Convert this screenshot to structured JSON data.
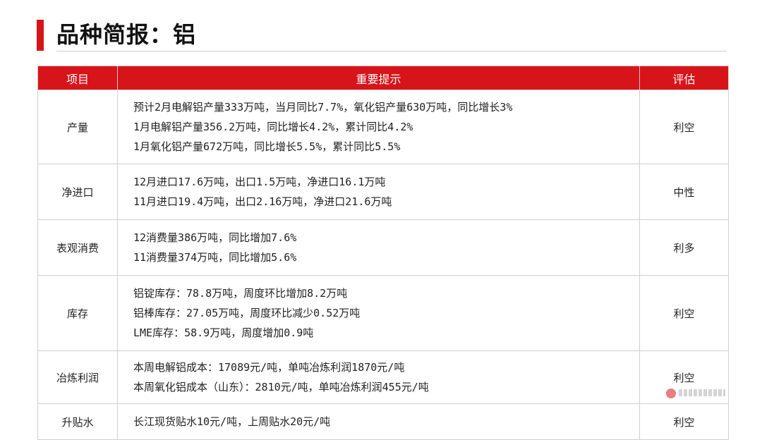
{
  "page": {
    "title": "品种简报：铝"
  },
  "table": {
    "headers": [
      "项目",
      "重要提示",
      "评估"
    ],
    "rows": [
      {
        "item": "产量",
        "hints": [
          "预计2月电解铝产量333万吨，当月同比7.7%，氧化铝产量630万吨，同比增长3%",
          "1月电解铝产量356.2万吨，同比增长4.2%，累计同比4.2%",
          "1月氧化铝产量672万吨，同比增长5.5%，累计同比5.5%"
        ],
        "assessment": "利空"
      },
      {
        "item": "净进口",
        "hints": [
          "12月进口17.6万吨，出口1.5万吨，净进口16.1万吨",
          "11月进口19.4万吨，出口2.16万吨，净进口21.6万吨"
        ],
        "assessment": "中性"
      },
      {
        "item": "表观消费",
        "hints": [
          "12消费量386万吨，同比增加7.6%",
          "11消费量374万吨，同比增加5.6%"
        ],
        "assessment": "利多"
      },
      {
        "item": "库存",
        "hints": [
          "铝锭库存：78.8万吨，周度环比增加8.2万吨",
          "铝棒库存：27.05万吨，周度环比减少0.52万吨",
          "LME库存：58.9万吨，周度增加0.9吨"
        ],
        "assessment": "利空"
      },
      {
        "item": "冶炼利润",
        "hints": [
          "本周电解铝成本：17089元/吨，单吨冶炼利润1870元/吨",
          "本周氧化铝成本（山东）：2810元/吨，单吨冶炼利润455元/吨"
        ],
        "assessment": "利空"
      },
      {
        "item": "升贴水",
        "hints": [
          "长江现货贴水10元/吨，上周贴水20元/吨"
        ],
        "assessment": "利空"
      }
    ]
  },
  "colors": {
    "accent": "#d7141a",
    "border": "#d0d0d0"
  }
}
